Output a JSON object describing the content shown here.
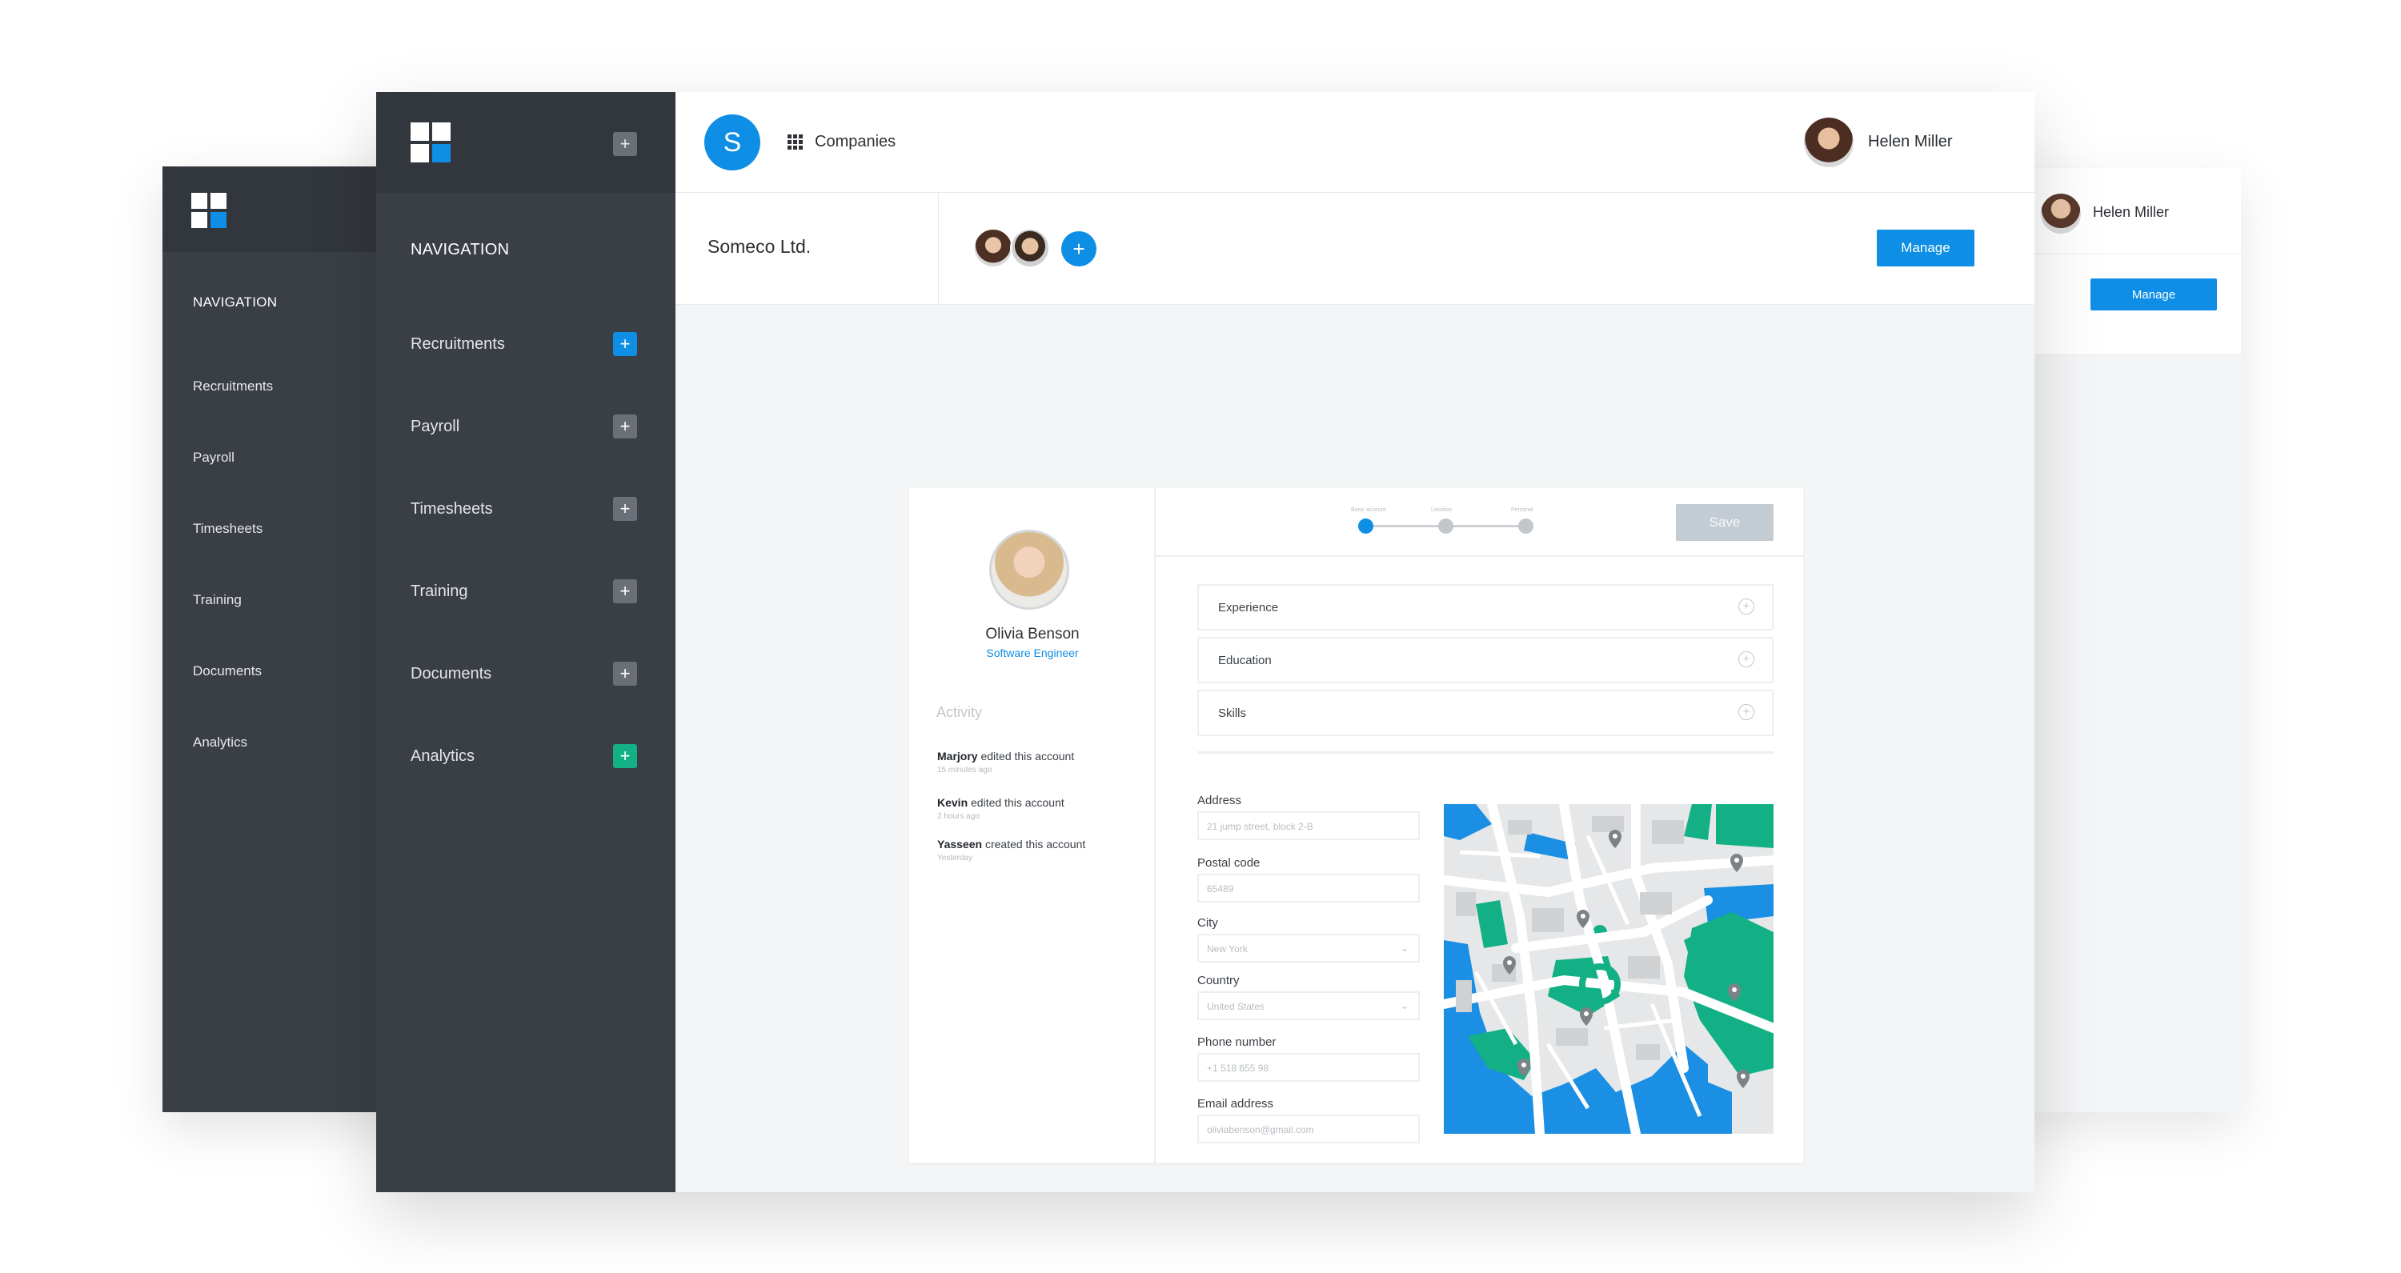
{
  "back_left": {
    "nav_title": "NAVIGATION",
    "items": [
      {
        "label": "Recruitments",
        "color": "#0e8ee4"
      },
      {
        "label": "Payroll",
        "color": "#6b7078"
      },
      {
        "label": "Timesheets",
        "color": "#6b7078"
      },
      {
        "label": "Training",
        "color": "#6b7078"
      },
      {
        "label": "Documents",
        "color": "#6b7078"
      },
      {
        "label": "Analytics",
        "color": "#13b086"
      }
    ]
  },
  "back_right": {
    "user_name": "Helen Miller",
    "manage_label": "Manage"
  },
  "sidebar": {
    "add_label": "+",
    "nav_title": "NAVIGATION",
    "items": [
      {
        "label": "Recruitments",
        "icon": "+",
        "color": "#0e8ee4"
      },
      {
        "label": "Payroll",
        "icon": "+",
        "color": "#6b7078"
      },
      {
        "label": "Timesheets",
        "icon": "+",
        "color": "#6b7078"
      },
      {
        "label": "Training",
        "icon": "+",
        "color": "#6b7078"
      },
      {
        "label": "Documents",
        "icon": "+",
        "color": "#6b7078"
      },
      {
        "label": "Analytics",
        "icon": "+",
        "color": "#13b086"
      }
    ]
  },
  "topbar": {
    "badge_letter": "S",
    "section_label": "Companies",
    "user_name": "Helen Miller"
  },
  "company": {
    "name": "Someco Ltd.",
    "add_member_label": "+",
    "manage_label": "Manage"
  },
  "profile": {
    "name": "Olivia Benson",
    "role": "Software Engineer",
    "activity_title": "Activity",
    "activity": [
      {
        "user": "Marjory",
        "action": "edited this account",
        "when": "15 minutes ago"
      },
      {
        "user": "Kevin",
        "action": "edited this account",
        "when": "2 hours ago"
      },
      {
        "user": "Yasseen",
        "action": "created this account",
        "when": "Yesterday"
      }
    ]
  },
  "wizard": {
    "steps": [
      "Basic account",
      "Location",
      "Personal"
    ],
    "current_step": 1,
    "save_label": "Save"
  },
  "sections": [
    {
      "label": "Experience",
      "icon": "+"
    },
    {
      "label": "Education",
      "icon": "+"
    },
    {
      "label": "Skills",
      "icon": "+"
    }
  ],
  "form": {
    "address": {
      "label": "Address",
      "value": "21 jump street, block 2-B"
    },
    "postal_code": {
      "label": "Postal code",
      "value": "65489"
    },
    "city": {
      "label": "City",
      "value": "New York"
    },
    "country": {
      "label": "Country",
      "value": "United States"
    },
    "phone": {
      "label": "Phone number",
      "value": "+1 518 655 98"
    },
    "email": {
      "label": "Email address",
      "value": "oliviabenson@gmail.com"
    },
    "dropdown_icon": "⌄"
  },
  "colors": {
    "accent": "#0e8ee4",
    "sidebar": "#3a3f46",
    "sidebar_header": "#32363d",
    "green": "#13b086",
    "map_water": "#1a8fe3"
  }
}
